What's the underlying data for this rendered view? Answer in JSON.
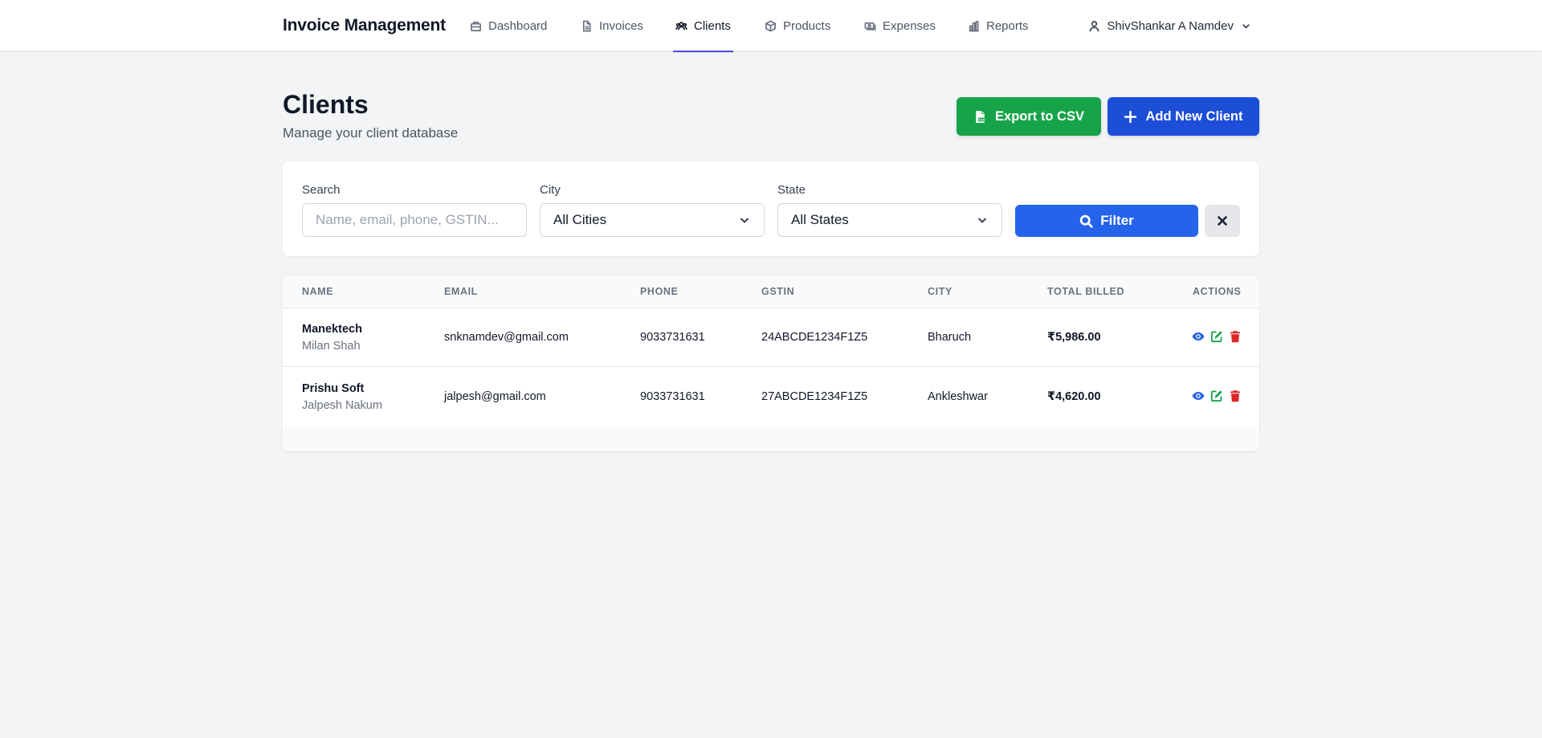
{
  "app": {
    "title": "Invoice Management"
  },
  "nav": {
    "items": [
      {
        "label": "Dashboard",
        "icon": "dashboard-icon"
      },
      {
        "label": "Invoices",
        "icon": "document-icon"
      },
      {
        "label": "Clients",
        "icon": "users-icon",
        "active": true
      },
      {
        "label": "Products",
        "icon": "box-icon"
      },
      {
        "label": "Expenses",
        "icon": "money-icon"
      },
      {
        "label": "Reports",
        "icon": "chart-bar-icon"
      }
    ],
    "user": {
      "name": "ShivShankar A Namdev",
      "icon": "user-icon"
    }
  },
  "header": {
    "title": "Clients",
    "subtitle": "Manage your client database",
    "export_label": "Export to CSV",
    "add_label": "Add New Client"
  },
  "filters": {
    "search": {
      "label": "Search",
      "placeholder": "Name, email, phone, GSTIN...",
      "value": ""
    },
    "city": {
      "label": "City",
      "selected": "All Cities"
    },
    "state": {
      "label": "State",
      "selected": "All States"
    },
    "filter_label": "Filter"
  },
  "table": {
    "columns": [
      "Name",
      "Email",
      "Phone",
      "GSTIN",
      "City",
      "Total Billed",
      "Actions"
    ],
    "rows": [
      {
        "name": "Manektech",
        "contact": "Milan Shah",
        "email": "snknamdev@gmail.com",
        "phone": "9033731631",
        "gstin": "24ABCDE1234F1Z5",
        "city": "Bharuch",
        "total": "₹5,986.00"
      },
      {
        "name": "Prishu Soft",
        "contact": "Jalpesh Nakum",
        "email": "jalpesh@gmail.com",
        "phone": "9033731631",
        "gstin": "27ABCDE1234F1Z5",
        "city": "Ankleshwar",
        "total": "₹4,620.00"
      }
    ]
  },
  "colors": {
    "accent": "#4f46e5",
    "export": "#16a34a",
    "add": "#1d4ed8",
    "filter": "#2563eb",
    "view_action": "#2563eb",
    "edit_action": "#16a34a",
    "delete_action": "#dc2626"
  }
}
